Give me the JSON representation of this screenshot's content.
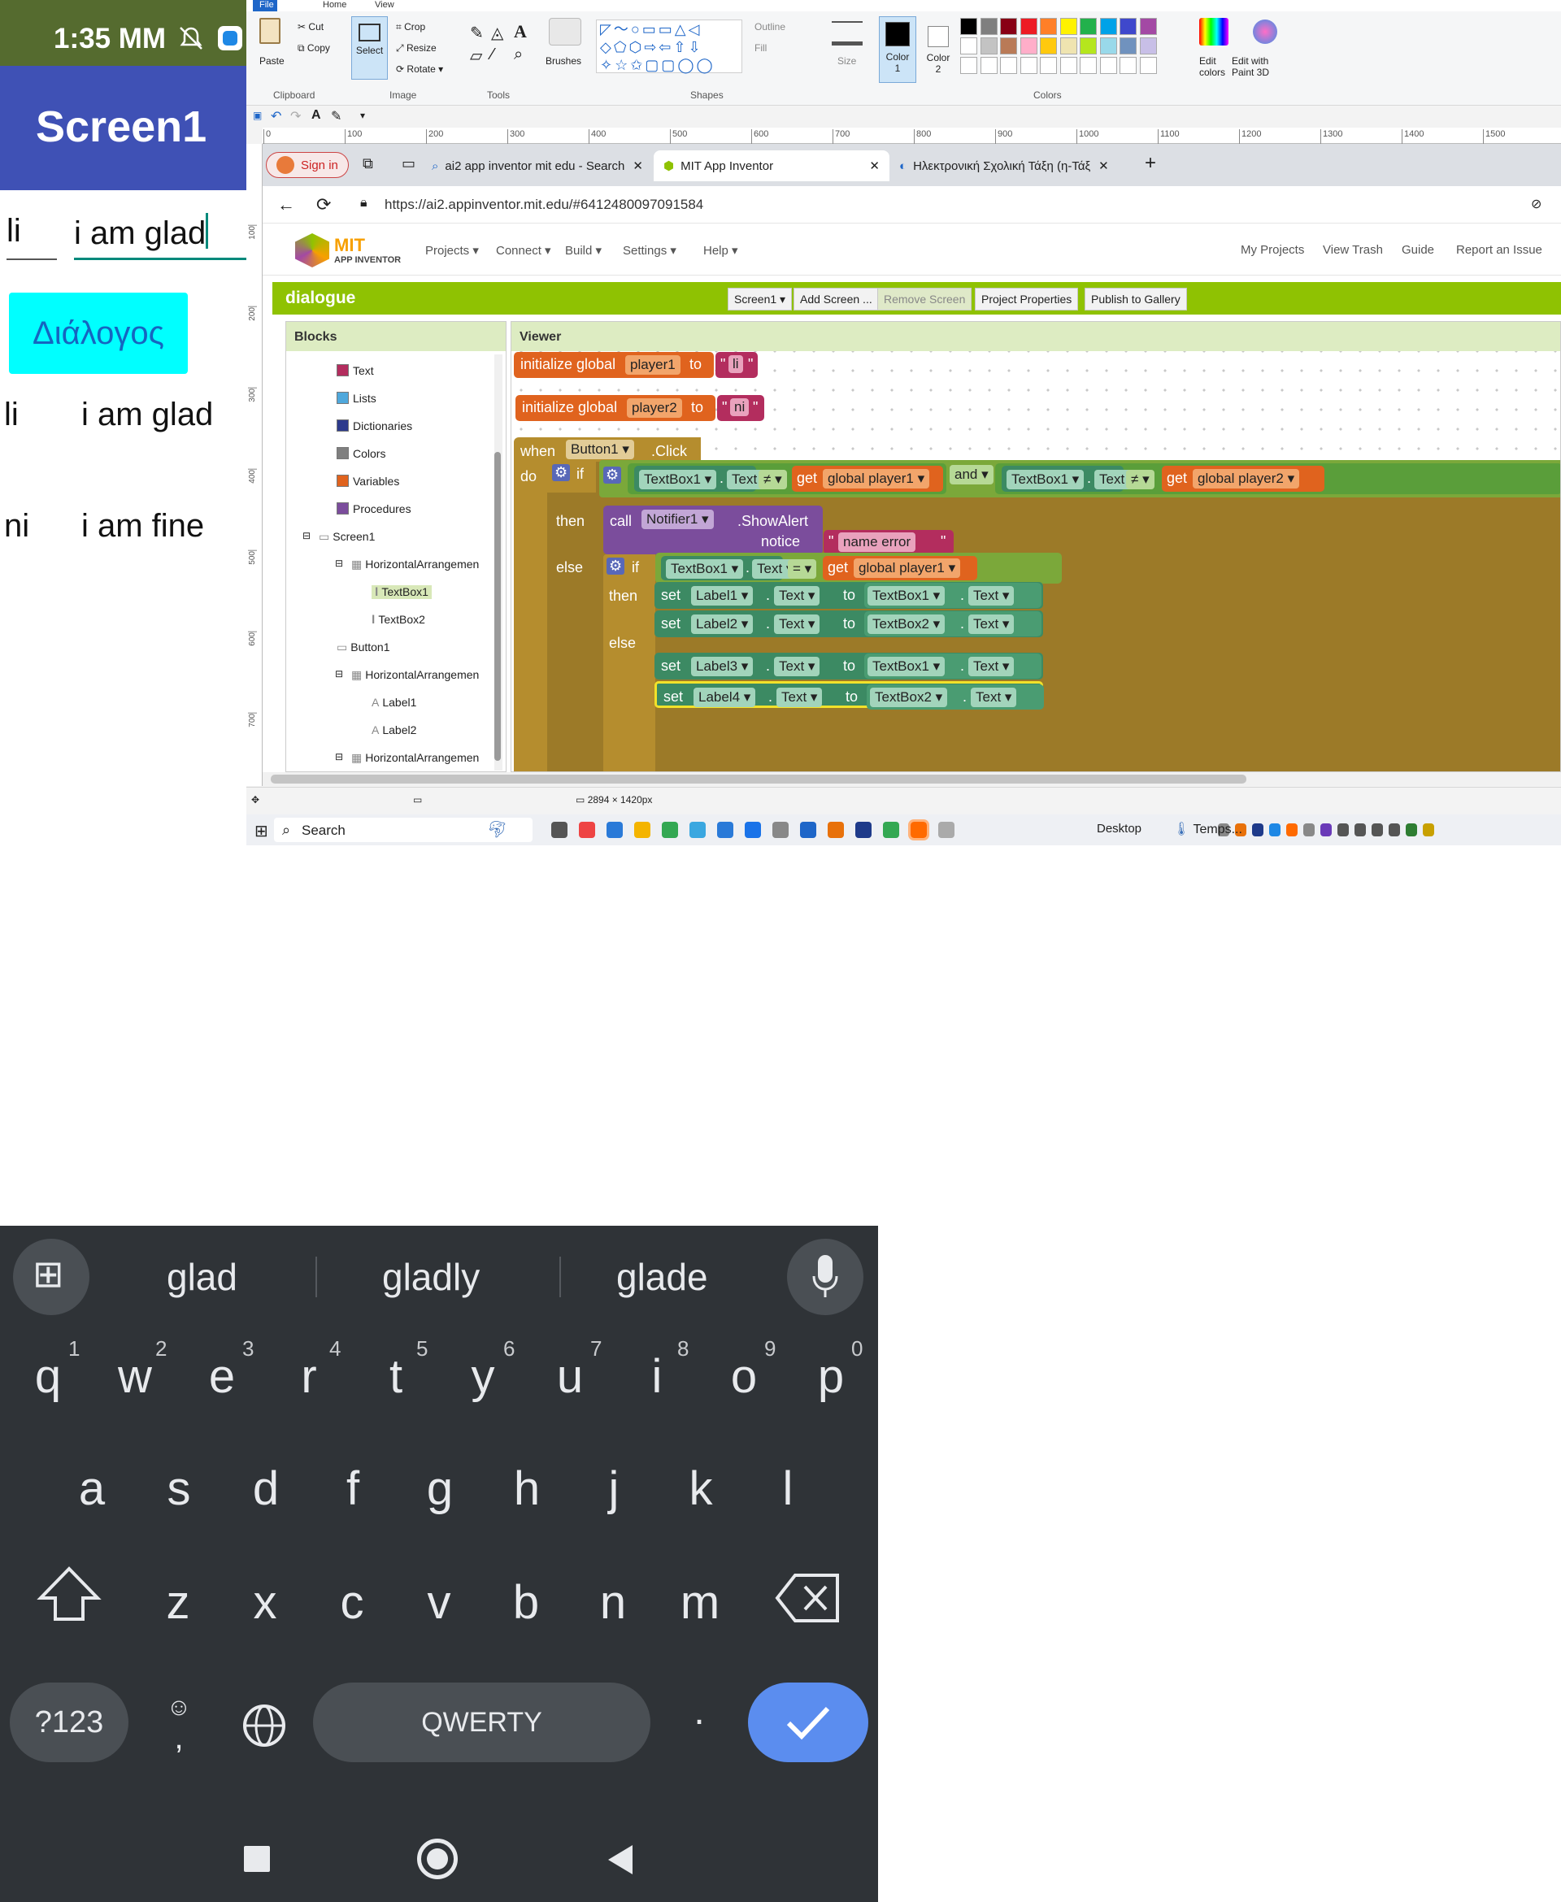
{
  "phone": {
    "status_time": "1:35 MM",
    "screen_title": "Screen1",
    "textbox1": "li",
    "textbox2": "i am glad",
    "dialog_button": "Διάλογος",
    "label1": "li",
    "label2": "i am glad",
    "label3": "ni",
    "label4": "i am fine"
  },
  "paint": {
    "menu_tabs": [
      "File",
      "Home",
      "View"
    ],
    "clipboard": {
      "paste": "Paste",
      "cut": "Cut",
      "copy": "Copy",
      "group": "Clipboard"
    },
    "image": {
      "select": "Select",
      "crop": "Crop",
      "resize": "Resize",
      "rotate": "Rotate",
      "group": "Image"
    },
    "tools_group": "Tools",
    "brushes": "Brushes",
    "shapes": {
      "outline": "Outline",
      "fill": "Fill",
      "group": "Shapes"
    },
    "size": "Size",
    "color1": "Color\n1",
    "color2": "Color\n2",
    "edit_colors": "Edit\ncolors",
    "edit_paint3d": "Edit with\nPaint 3D",
    "colors_group": "Colors",
    "palette_row1": [
      "#000000",
      "#7f7f7f",
      "#880015",
      "#ed1c24",
      "#ff7f27",
      "#fff200",
      "#22b14c",
      "#00a2e8",
      "#3f48cc",
      "#a349a4"
    ],
    "palette_row2": [
      "#ffffff",
      "#c3c3c3",
      "#b97a57",
      "#ffaec9",
      "#ffc90e",
      "#efe4b0",
      "#b5e61d",
      "#99d9ea",
      "#7092be",
      "#c8bfe7"
    ],
    "ruler_h": [
      "0",
      "100",
      "200",
      "300",
      "400",
      "500",
      "600",
      "700",
      "800",
      "900",
      "1000",
      "1100",
      "1200",
      "1300",
      "1400",
      "1500"
    ],
    "ruler_v": [
      "100",
      "200",
      "300",
      "400",
      "500",
      "600",
      "700"
    ],
    "canvas_size": "2894 × 1420px"
  },
  "browser": {
    "signin": "Sign in",
    "tabs": [
      "ai2 app inventor mit edu - Search",
      "MIT App Inventor",
      "Ηλεκτρονική Σχολική Τάξη (η-Τάξ"
    ],
    "url": "https://ai2.appinventor.mit.edu/#6412480097091584"
  },
  "appinventor": {
    "logo_mit": "MIT",
    "logo_sub": "APP INVENTOR",
    "nav_left": [
      "Projects ▾",
      "Connect ▾",
      "Build ▾",
      "Settings ▾",
      "Help ▾"
    ],
    "nav_right": [
      "My Projects",
      "View Trash",
      "Guide",
      "Report an Issue"
    ],
    "project_name": "dialogue",
    "toolbar": [
      "Screen1 ▾",
      "Add Screen ...",
      "Remove Screen",
      "Project Properties",
      "Publish to Gallery"
    ],
    "blocks_title": "Blocks",
    "viewer_title": "Viewer",
    "block_cats": [
      {
        "name": "Text",
        "color": "#b32d5e"
      },
      {
        "name": "Lists",
        "color": "#4fa8dc"
      },
      {
        "name": "Dictionaries",
        "color": "#2d3a8c"
      },
      {
        "name": "Colors",
        "color": "#7f7f7f"
      },
      {
        "name": "Variables",
        "color": "#e0631e"
      },
      {
        "name": "Procedures",
        "color": "#7b4d9c"
      }
    ],
    "tree": [
      "Screen1",
      "HorizontalArrangemen",
      "TextBox1",
      "TextBox2",
      "Button1",
      "HorizontalArrangemen",
      "Label1",
      "Label2",
      "HorizontalArrangemen"
    ],
    "blocks": {
      "init": "initialize global",
      "to": "to",
      "player1": "player1",
      "player2": "player2",
      "li": "li",
      "ni": "ni",
      "when": "when",
      "button1": "Button1",
      "click": ".Click",
      "do": "do",
      "if": "if",
      "then": "then",
      "else": "else",
      "textbox1": "TextBox1",
      "textbox2": "TextBox2",
      "text": "Text",
      "neq": "≠",
      "eq": "=",
      "get": "get",
      "global_player1": "global player1",
      "global_player2": "global player2",
      "and": "and",
      "call": "call",
      "notifier": "Notifier1",
      "showalert": ".ShowAlert",
      "notice": "notice",
      "name_error": "name error",
      "set": "set",
      "label1": "Label1",
      "label2": "Label2",
      "label3": "Label3",
      "label4": "Label4",
      "dot": ".",
      "quote": "\""
    }
  },
  "taskbar": {
    "search": "Search",
    "desktop": "Desktop",
    "temps": "Temps..."
  },
  "keyboard": {
    "suggestions": [
      "glad",
      "gladly",
      "glade"
    ],
    "row1": [
      "q",
      "w",
      "e",
      "r",
      "t",
      "y",
      "u",
      "i",
      "o",
      "p"
    ],
    "row1_hints": [
      "1",
      "2",
      "3",
      "4",
      "5",
      "6",
      "7",
      "8",
      "9",
      "0"
    ],
    "row2": [
      "a",
      "s",
      "d",
      "f",
      "g",
      "h",
      "j",
      "k",
      "l"
    ],
    "row3": [
      "z",
      "x",
      "c",
      "v",
      "b",
      "n",
      "m"
    ],
    "symbols": "?123",
    "comma": ",",
    "space": "QWERTY",
    "period": "."
  }
}
